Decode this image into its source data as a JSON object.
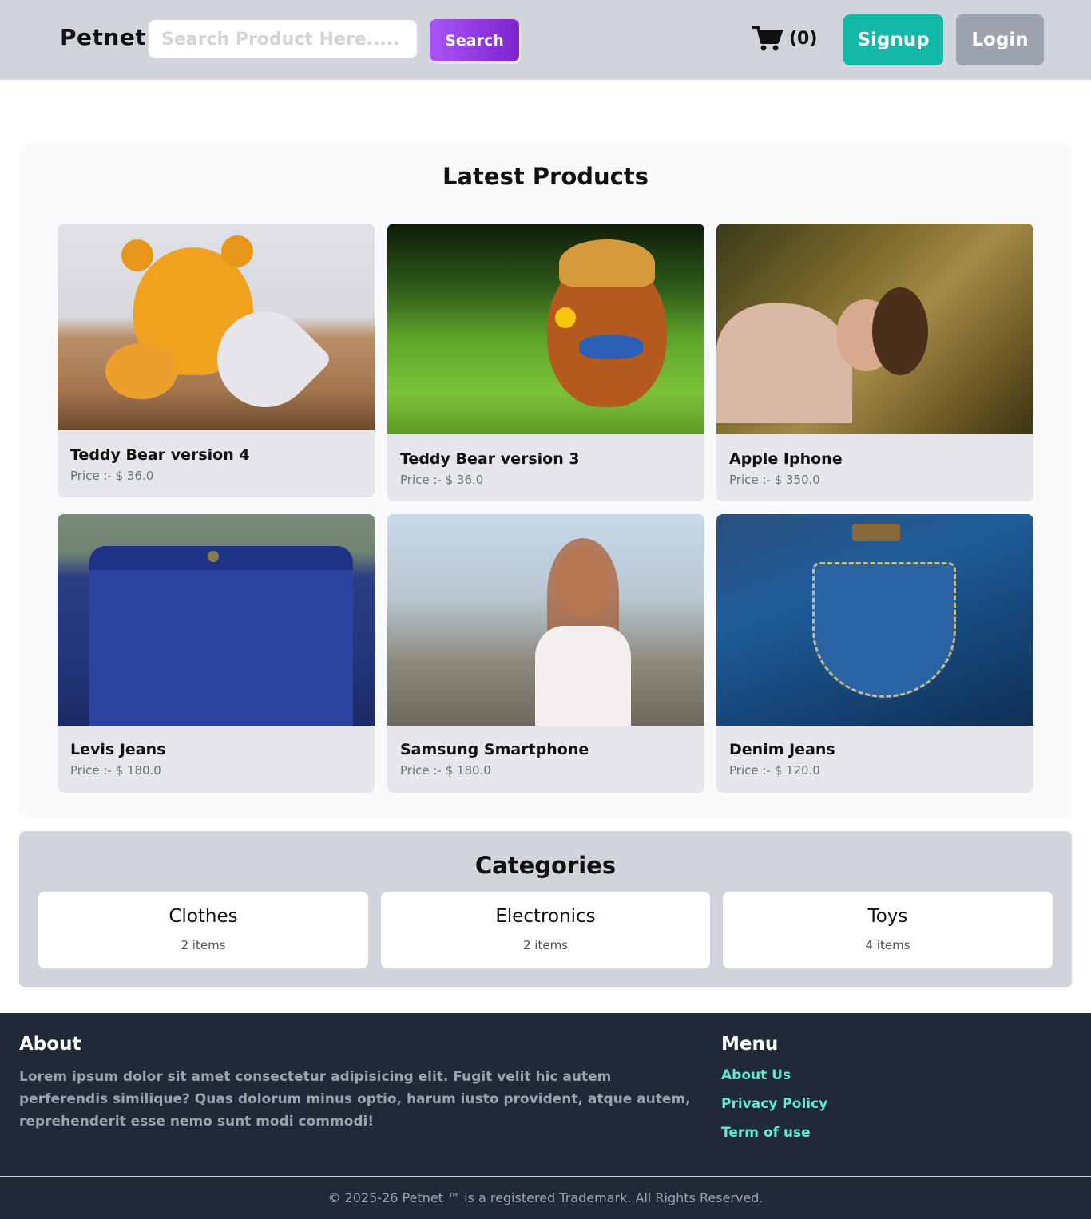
{
  "header": {
    "brand": "Petnet",
    "search_placeholder": "Search Product Here.....",
    "search_label": "Search",
    "cart_count": "(0)",
    "signup_label": "Signup",
    "login_label": "Login"
  },
  "latest": {
    "title": "Latest Products",
    "products": [
      {
        "name": "Teddy Bear version 4",
        "price": "Price :- $ 36.0"
      },
      {
        "name": "Teddy Bear version 3",
        "price": "Price :- $ 36.0"
      },
      {
        "name": "Apple Iphone",
        "price": "Price :- $ 350.0"
      },
      {
        "name": "Levis Jeans",
        "price": "Price :- $ 180.0"
      },
      {
        "name": "Samsung Smartphone",
        "price": "Price :- $ 180.0"
      },
      {
        "name": "Denim Jeans",
        "price": "Price :- $ 120.0"
      }
    ]
  },
  "categories": {
    "title": "Categories",
    "items": [
      {
        "name": "Clothes",
        "count": "2 items"
      },
      {
        "name": "Electronics",
        "count": "2 items"
      },
      {
        "name": "Toys",
        "count": "4 items"
      }
    ]
  },
  "footer": {
    "about_title": "About",
    "about_text": "Lorem ipsum dolor sit amet consectetur adipisicing elit. Fugit velit hic autem perferendis similique? Quas dolorum minus optio, harum iusto provident, atque autem, reprehenderit esse nemo sunt modi commodi!",
    "menu_title": "Menu",
    "links": [
      "About Us",
      "Privacy Policy",
      "Term of use"
    ],
    "copyright": "© 2025-26  Petnet ™ is a registered Trademark. All Rights Reserved."
  },
  "colors": {
    "header_bg": "#d1d5db",
    "search_button": "#9333ea",
    "signup_button": "#14b8a6",
    "login_button": "#9ca3af",
    "footer_bg": "#1f2937",
    "footer_link": "#5eead4"
  },
  "icons": {
    "cart": "cart-icon"
  }
}
